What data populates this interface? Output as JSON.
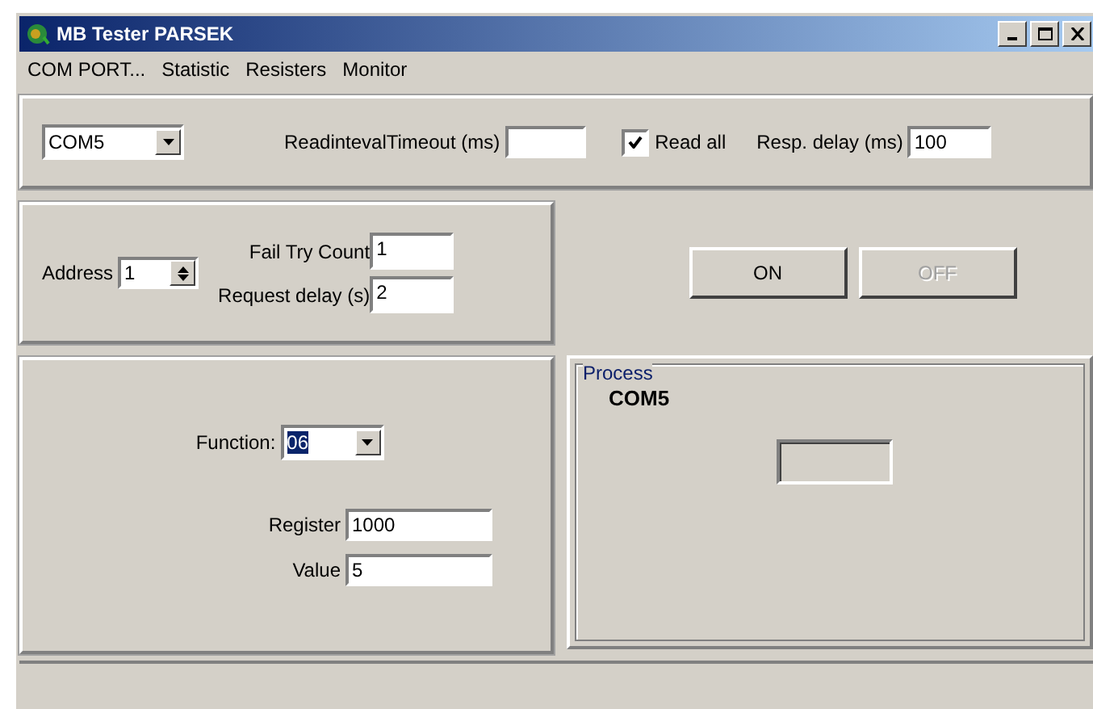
{
  "window": {
    "title": "MB Tester PARSEK"
  },
  "menu": [
    "COM PORT...",
    "Statistic",
    "Resisters",
    "Monitor"
  ],
  "connection": {
    "port": "COM5",
    "timeout": {
      "label": "ReadintevalTimeout (ms)"
    },
    "read_all": {
      "label": "Read all",
      "checked": true
    },
    "resp_delay": {
      "label": "Resp. delay (ms)",
      "value": "100"
    }
  },
  "device": {
    "address": {
      "label": "Address",
      "value": "1"
    },
    "fail_try": {
      "label": "Fail Try Count",
      "value": "1"
    },
    "request_delay": {
      "label": "Request delay (s)",
      "value": "2"
    }
  },
  "buttons": [
    {
      "label": "ON",
      "disabled": false
    },
    {
      "label": "OFF",
      "disabled": true
    }
  ],
  "request": {
    "function": {
      "label": "Function:",
      "value": "06",
      "highlighted": true
    },
    "register": {
      "label": "Register",
      "value": "1000"
    },
    "value": {
      "label": "Value",
      "value": "5"
    }
  },
  "process": {
    "title": "Process",
    "port": "COM5"
  }
}
